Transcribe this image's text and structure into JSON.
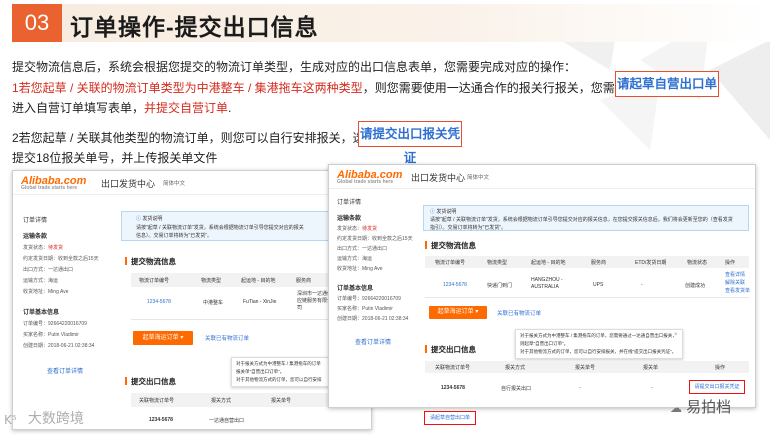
{
  "header": {
    "number": "03",
    "title": "订单操作-提交出口信息"
  },
  "intro": {
    "line1": "提交物流信息后，系统会根据您提交的物流订单类型，生成对应的出口信息表单，您需要完成对应的操作：",
    "line2_red1": "1若您起草 / 关联的物流订单类型为中港整车 / 集港拖车这两种类型",
    "line2_black": "，则您需要使用一达通合作的报关行报关，您需要选择",
    "line3_black": "进入自营订单填写表单，",
    "line3_red": "并提交自营订单",
    "line3_end": ".",
    "line4": "2若您起草 / 关联其他类型的物流订单，则您可以自行安排报关，选择",
    "line5": "提交18位报关单号，并上传报关单文件",
    "callout1": "请起草自营出口单",
    "callout2": "请提交出口报关凭证"
  },
  "shot1": {
    "logo": "Alibaba.com",
    "logo_sub": "Global trade starts here",
    "center_title": "出口发货中心",
    "lang": "简体中文",
    "side": {
      "title": "订单详情",
      "sec1": "运输条款",
      "status_label": "发货状态：",
      "status_value": "待发货",
      "date_label": "约定发货日期：",
      "date_value": "收到全款之后15天",
      "method_label": "出口方式：",
      "method_value": "一达通出口",
      "transport_label": "运输方式：",
      "transport_value": "海运",
      "receiver_label": "收货地址：",
      "receiver_value": "Ming Ave",
      "sec2": "订单基本信息",
      "order_label": "订单编号：",
      "order_value": "92664220016709",
      "buyer_label": "买家名称：",
      "buyer_value": "Putin Vladimir",
      "created_label": "创建日期：",
      "created_value": "2018-06-21 02:38:34",
      "view_link": "查看订单详情"
    },
    "notice_title": "发货说明",
    "notice_line1": "请按\"起草 / 关联物流订单\"发货，系统会根据物流订单引导您提交对应的报关",
    "notice_line2": "信息）。交易订单将转为\"已发货\"。",
    "logistics_title": "提交物流信息",
    "cols": [
      "物流订单编号",
      "物流类型",
      "起运地 - 目的地",
      "服务商"
    ],
    "row": [
      "1234-5678",
      "中港整车",
      "FuTian - XinJie",
      "深圳市一达通供应链服务有限公司"
    ],
    "draft_btn": "起草海运订单",
    "link_btn": "关联已有物流订单",
    "export_title": "提交出口信息",
    "export_cols": [
      "关联物流订单号",
      "报关方式",
      "报关单号"
    ],
    "export_row": [
      "1234-5678",
      "一达通自营出口"
    ],
    "tip_line1": "对于报关方式为中港整车 / 集港拖车的订单",
    "tip_line2": "报关单\"自营出口订单\"。",
    "tip_line3": "对于其他物流方式的订单，您可以自行安排",
    "red_btn": "请起草自营出口单"
  },
  "shot2": {
    "logo": "Alibaba.com",
    "logo_sub": "Global trade starts here",
    "center_title": "出口发货中心",
    "lang": "简体中文",
    "side": {
      "title": "订单详情",
      "sec1": "运输条款",
      "status_label": "发货状态：",
      "status_value": "待发货",
      "date_label": "约定发货日期：",
      "date_value": "收到全款之后15天",
      "method_label": "出口方式：",
      "method_value": "一达通出口",
      "transport_label": "运输方式：",
      "transport_value": "海运",
      "receiver_label": "收货地址：",
      "receiver_value": "Ming Ave",
      "sec2": "订单基本信息",
      "order_label": "订单编号：",
      "order_value": "92664220016709",
      "buyer_label": "买家名称：",
      "buyer_value": "Putin Vladimir",
      "created_label": "创建日期：",
      "created_value": "2018-06-21 02:38:34",
      "view_link": "查看订单详情"
    },
    "notice_title": "发货说明",
    "notice_line1": "请按\"起草 / 关联物流订单\"发货，系统会根据物流订单引导您提交对应的报关信息，在您提交报关信息后，我们将会更新至您的（查看发货",
    "notice_line2": "指引）。交易订单将转为\"已发货\"。",
    "logistics_title": "提交物流信息",
    "cols": [
      "物流订单编号",
      "物流类型",
      "起运地 - 目的地",
      "服务商",
      "ETD/发货日期",
      "物流状态",
      "操作"
    ],
    "row": [
      "1234-5678",
      "快递门到门",
      "HANGZHOU - AUSTRALIA",
      "UPS",
      "-",
      "创建成功"
    ],
    "row_ops": [
      "查看详情",
      "解除关联",
      "查看发货单"
    ],
    "draft_btn": "起草海运订单",
    "link_btn": "关联已有物流订单",
    "export_title": "提交出口信息",
    "export_cols": [
      "关联物流订单号",
      "报关方式",
      "报关单号",
      "报关单",
      "操作"
    ],
    "export_row": [
      "1234-5678",
      "自行报关出口",
      "-",
      "-"
    ],
    "tip_line1": "对于报关方式为中港整车 / 集港拖车的订单，您需要通过一达通自营出口报关，",
    "tip_line2": "则起草\"自营出口订单\"。",
    "tip_line3": "对于其他物流方式的订单，您可以自行安排报关，并在线\"提交出口报关凭证\"。",
    "red_btn": "请提交出口报关凭证"
  },
  "watermarks": {
    "left": "大数跨境",
    "right": "易拍档"
  }
}
